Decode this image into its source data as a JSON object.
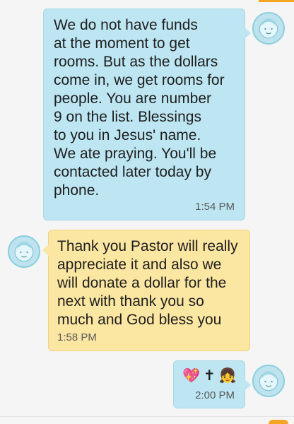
{
  "conversation": {
    "messages": [
      {
        "direction": "outgoing",
        "text": "We do not have funds\nat the moment to get\nrooms. But as the dollars\ncome in, we get rooms for\npeople. You are number\n9 on the list. Blessings\nto you in Jesus' name.\nWe ate praying. You'll be\ncontacted later today by\nphone.",
        "time": "1:54 PM"
      },
      {
        "direction": "incoming",
        "text": "Thank you Pastor will really\nappreciate it and also we\nwill donate a dollar for the\nnext with thank you so\nmuch and God bless you",
        "time": "1:58 PM"
      },
      {
        "direction": "outgoing",
        "emojis": [
          "💖",
          "✝",
          "👧"
        ],
        "emoji_names": [
          "sparkling-heart-icon",
          "latin-cross-icon",
          "girl-face-icon"
        ],
        "time": "2:00 PM"
      }
    ]
  },
  "colors": {
    "outgoing_bubble": "#bde6f2",
    "incoming_bubble": "#fbe6a2",
    "avatar": "#bfe3ee",
    "accent": "#f4a623"
  }
}
